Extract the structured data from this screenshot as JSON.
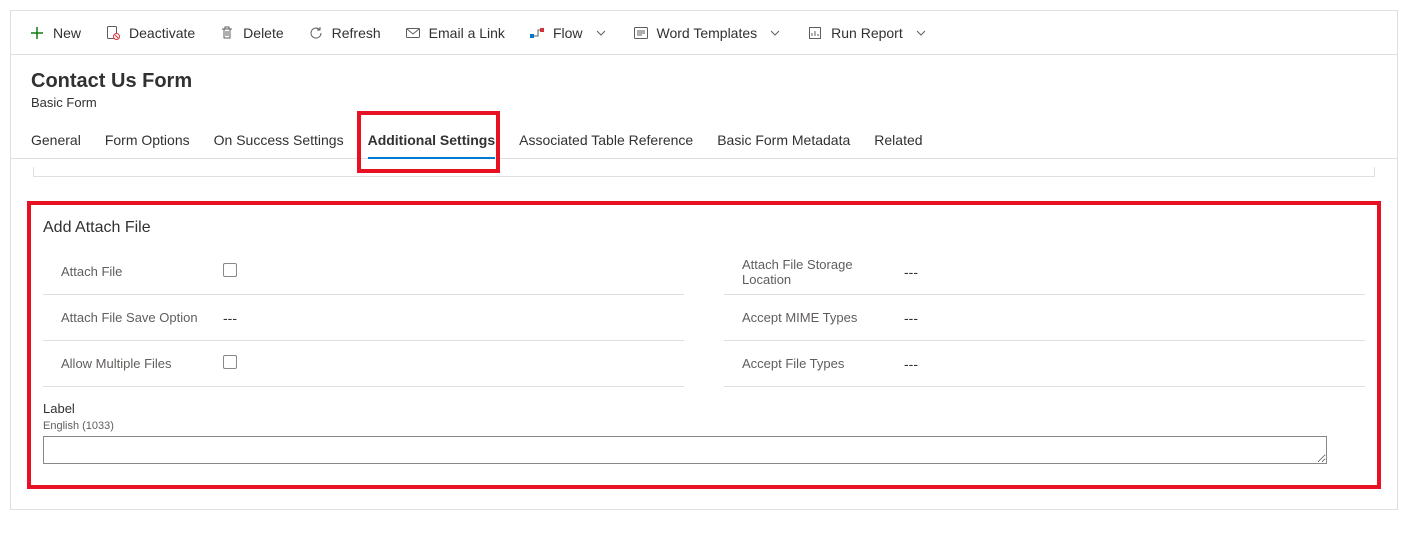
{
  "commands": {
    "new": "New",
    "deactivate": "Deactivate",
    "delete": "Delete",
    "refresh": "Refresh",
    "emailLink": "Email a Link",
    "flow": "Flow",
    "wordTemplates": "Word Templates",
    "runReport": "Run Report"
  },
  "header": {
    "title": "Contact Us Form",
    "subtitle": "Basic Form"
  },
  "tabs": {
    "general": "General",
    "formOptions": "Form Options",
    "onSuccess": "On Success Settings",
    "additional": "Additional Settings",
    "associated": "Associated Table Reference",
    "metadata": "Basic Form Metadata",
    "related": "Related"
  },
  "section": {
    "title": "Add Attach File",
    "left": {
      "attachFile": {
        "label": "Attach File"
      },
      "saveOption": {
        "label": "Attach File Save Option",
        "value": "---"
      },
      "allowMultiple": {
        "label": "Allow Multiple Files"
      }
    },
    "right": {
      "storage": {
        "label": "Attach File Storage Location",
        "value": "---"
      },
      "mime": {
        "label": "Accept MIME Types",
        "value": "---"
      },
      "fileTypes": {
        "label": "Accept File Types",
        "value": "---"
      }
    },
    "labelBlock": {
      "title": "Label",
      "lang": "English (1033)",
      "value": ""
    }
  }
}
